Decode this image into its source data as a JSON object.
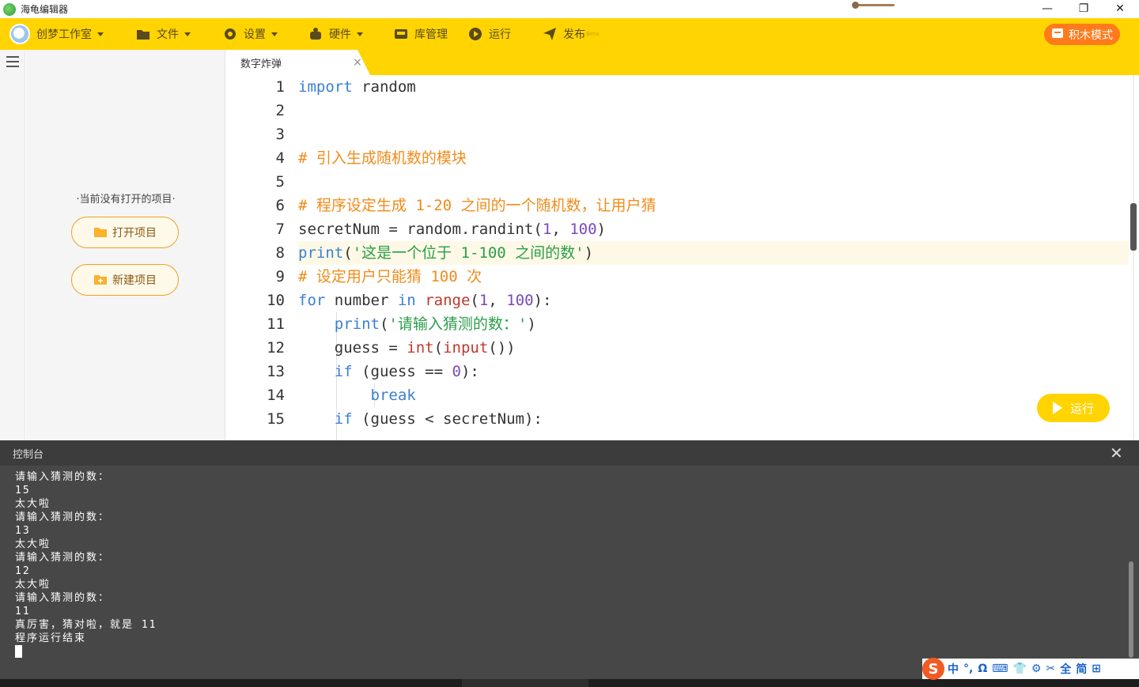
{
  "window": {
    "title": "海龟编辑器",
    "minimize": "—",
    "maximize": "❐",
    "close": "✕"
  },
  "toolbar": {
    "studio": "创梦工作室",
    "file": "文件",
    "settings": "设置",
    "hardware": "硬件",
    "library": "库管理",
    "run": "运行",
    "publish": "发布",
    "publish_badge": "Beta",
    "block_mode": "积木模式",
    "accent": "#ffd400"
  },
  "sidebar": {
    "no_project": "·当前没有打开的项目·",
    "open_project": "打开项目",
    "new_project": "新建项目"
  },
  "tabs": [
    {
      "label": "数字炸弹",
      "close": "×"
    }
  ],
  "editor": {
    "line_numbers": [
      "1",
      "2",
      "3",
      "4",
      "5",
      "6",
      "7",
      "8",
      "9",
      "10",
      "11",
      "12",
      "13",
      "14",
      "15"
    ],
    "run_button": "运行"
  },
  "console": {
    "title": "控制台",
    "close": "✕",
    "lines": [
      "请输入猜测的数：",
      "15",
      "太大啦",
      "请输入猜测的数：",
      "13",
      "太大啦",
      "请输入猜测的数：",
      "12",
      "太大啦",
      "请输入猜测的数：",
      "11",
      "真厉害，猜对啦，就是 11",
      "程序运行结束"
    ]
  },
  "ime": {
    "logo": "S",
    "glyphs": [
      "中",
      "°,",
      "Ω",
      "⌨",
      "👕",
      "⚙",
      "✂",
      "全",
      "简",
      "⊞"
    ]
  }
}
